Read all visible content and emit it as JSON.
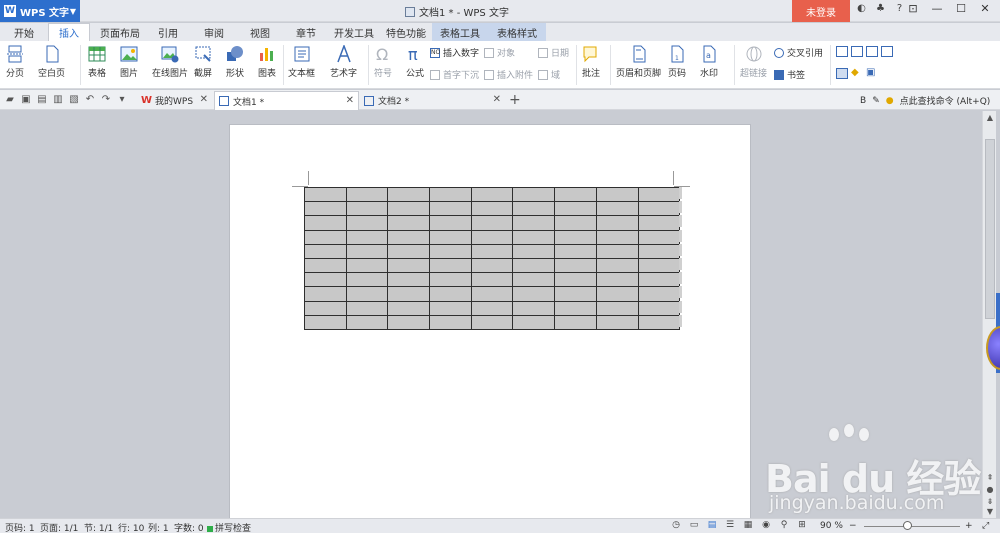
{
  "titlebar": {
    "app_name": "WPS 文字",
    "window_title": "文档1 * - WPS 文字",
    "login_label": "未登录",
    "help_label": "?"
  },
  "menu": {
    "tabs": [
      {
        "label": "开始"
      },
      {
        "label": "插入"
      },
      {
        "label": "页面布局"
      },
      {
        "label": "引用"
      },
      {
        "label": "审阅"
      },
      {
        "label": "视图"
      },
      {
        "label": "章节"
      },
      {
        "label": "开发工具"
      },
      {
        "label": "特色功能"
      },
      {
        "label": "表格工具"
      },
      {
        "label": "表格样式"
      }
    ],
    "active_tab": "插入"
  },
  "ribbon": {
    "page_break": "分页",
    "blank_page": "空白页",
    "table": "表格",
    "picture": "图片",
    "online_picture": "在线图片",
    "screenshot": "截屏",
    "shape": "形状",
    "chart": "图表",
    "textbox": "文本框",
    "wordart": "艺术字",
    "symbol": "符号",
    "formula": "公式",
    "insert_number": "插入数字",
    "object": "对象",
    "date": "日期",
    "drop_cap": "首字下沉",
    "attachment": "插入附件",
    "field": "域",
    "comment": "批注",
    "header_footer": "页眉和页脚",
    "page_number": "页码",
    "watermark": "水印",
    "hyperlink": "超链接",
    "cross_reference": "交叉引用",
    "bookmark": "书签"
  },
  "doc_tabs": [
    {
      "label": "我的WPS"
    },
    {
      "label": "文档1 *"
    },
    {
      "label": "文档2 *"
    }
  ],
  "command_search": "点此查找命令 (Alt+Q)",
  "table": {
    "rows": 10,
    "cols": 9,
    "cell_color": "#c8c8c8"
  },
  "watermark": {
    "brand": "Bai du 经验",
    "url": "jingyan.baidu.com"
  },
  "statusbar": {
    "page_num": "页码: 1",
    "pages": "页面: 1/1",
    "section": "节: 1/1",
    "row": "行: 10",
    "col": "列: 1",
    "word_count": "字数: 0",
    "spell_check": "拼写检查",
    "zoom": "90 %"
  },
  "colors": {
    "accent": "#2d6fcd",
    "login": "#e8604c"
  }
}
